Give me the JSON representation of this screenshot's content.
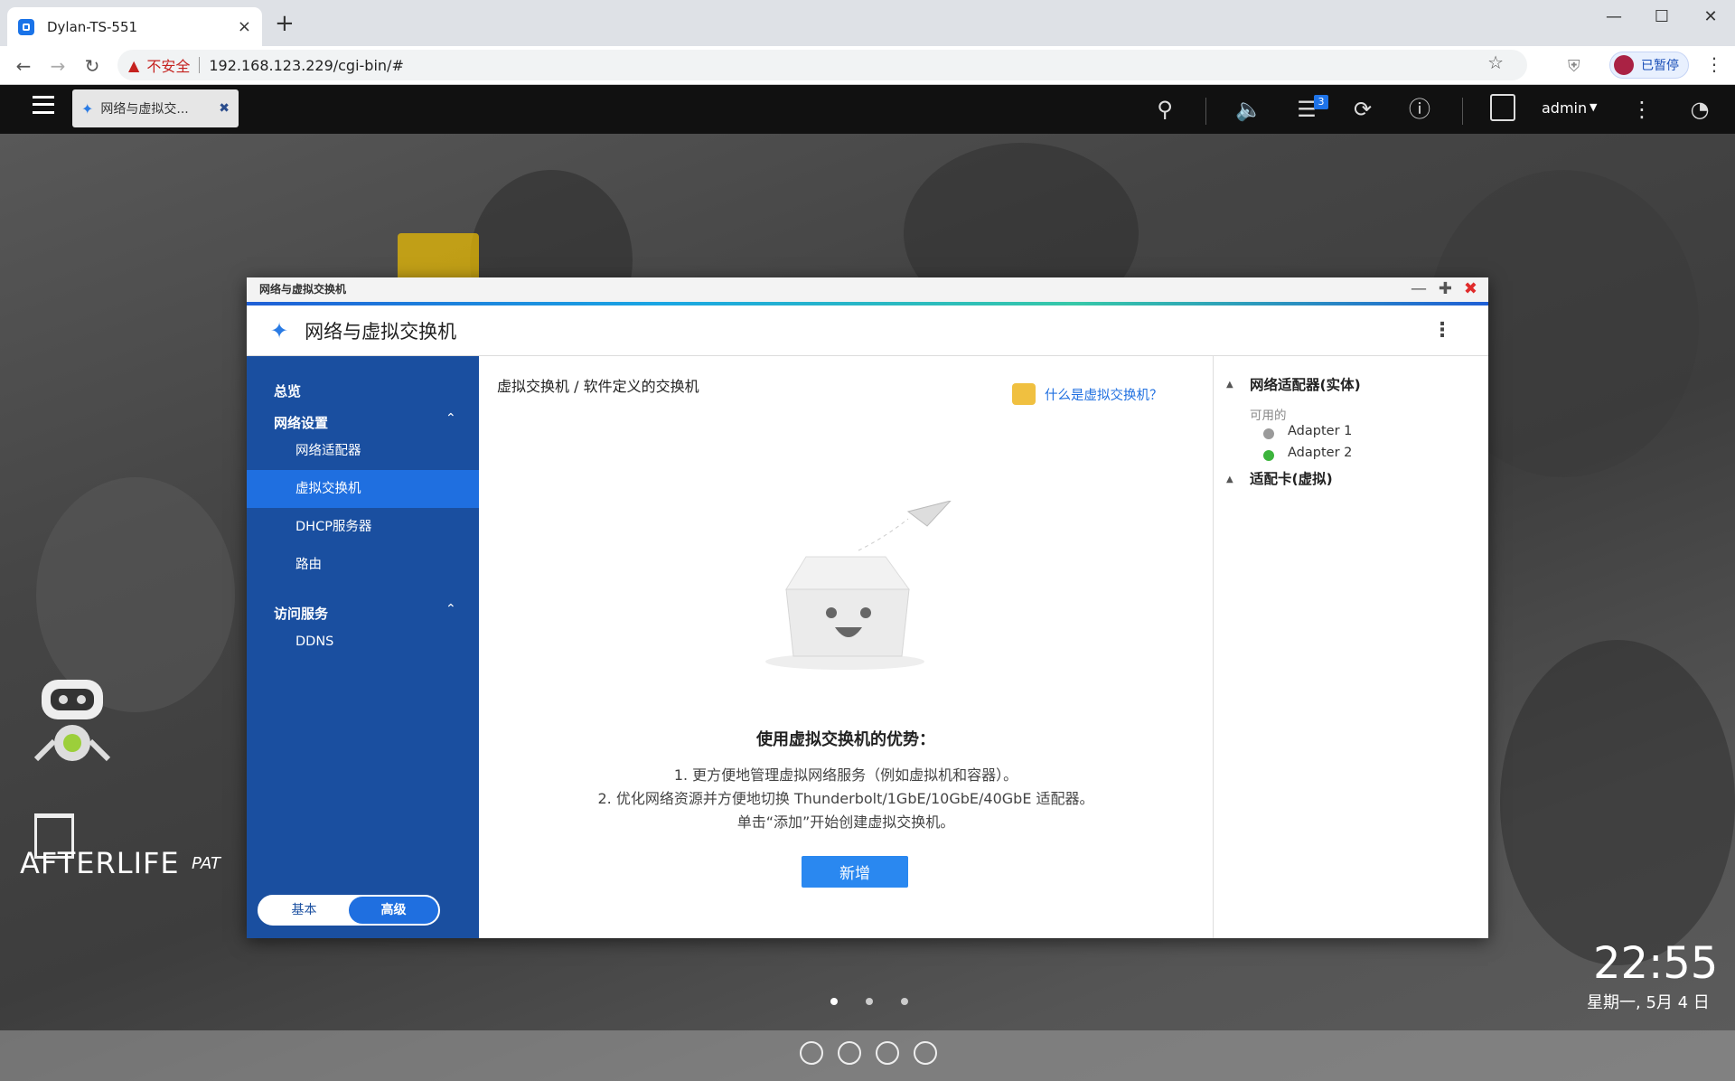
{
  "browser": {
    "tab_title": "Dylan-TS-551",
    "tab_close": "×",
    "new_tab": "+",
    "security_label": "不安全",
    "url": "192.168.123.229/cgi-bin/#",
    "profile_label": "已暂停"
  },
  "qts": {
    "app_tab_title": "网络与虚拟交...",
    "notification_count": "3",
    "user": "admin"
  },
  "window": {
    "titlebar": "网络与虚拟交换机",
    "header_title": "网络与虚拟交换机"
  },
  "sidebar": {
    "overview": "总览",
    "group_network": "网络设置",
    "items_network": [
      "网络适配器",
      "虚拟交换机",
      "DHCP服务器",
      "路由"
    ],
    "group_access": "访问服务",
    "items_access": [
      "DDNS"
    ],
    "active_item": "虚拟交换机",
    "mode_basic": "基本",
    "mode_advanced": "高级"
  },
  "main": {
    "breadcrumb": "虚拟交换机 / 软件定义的交换机",
    "help_link": "什么是虚拟交换机？",
    "empty_title": "使用虚拟交换机的优势：",
    "empty_lines": [
      "1. 更方便地管理虚拟网络服务（例如虚拟机和容器）。",
      "2. 优化网络资源并方便地切换 Thunderbolt/1GbE/10GbE/40GbE 适配器。",
      "单击“添加”开始创建虚拟交换机。"
    ],
    "add_button": "新增"
  },
  "right_panel": {
    "physical_header": "网络适配器(实体)",
    "available_label": "可用的",
    "adapters": [
      {
        "name": "Adapter 1",
        "status_color": "#9a9a9a"
      },
      {
        "name": "Adapter 2",
        "status_color": "#3cb43c"
      }
    ],
    "virtual_header": "适配卡(虚拟)"
  },
  "desktop": {
    "clock": "22:55",
    "date": "星期一, 5月 4 日",
    "wallpaper_brand": "AFTERLIFE",
    "wallpaper_brand2": "PAT"
  },
  "colors": {
    "sidebar_bg": "#1a4fa0",
    "sidebar_active": "#1f6fe0",
    "accent": "#2a88f0",
    "close_red": "#e02b2b"
  }
}
